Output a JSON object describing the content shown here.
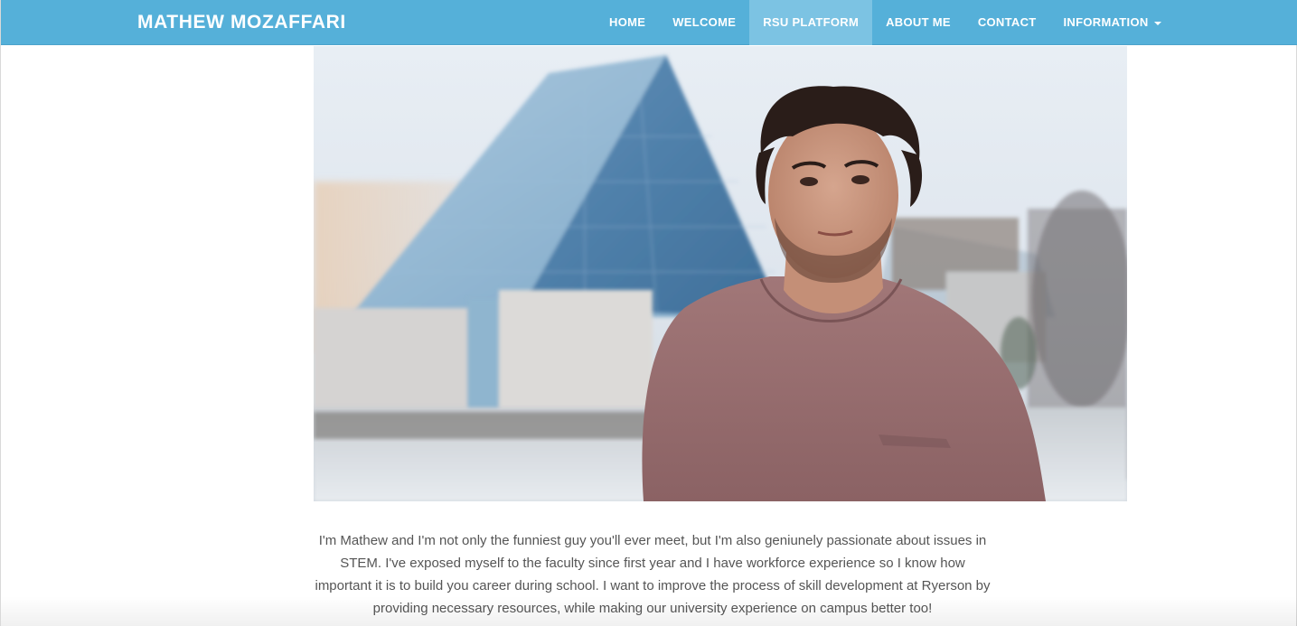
{
  "site": {
    "brand": "MATHEW MOZAFFARI"
  },
  "nav": {
    "items": [
      {
        "label": "HOME",
        "active": false
      },
      {
        "label": "WELCOME",
        "active": false
      },
      {
        "label": "RSU PLATFORM",
        "active": true
      },
      {
        "label": "ABOUT ME",
        "active": false
      },
      {
        "label": "CONTACT",
        "active": false
      },
      {
        "label": "INFORMATION",
        "active": false,
        "dropdown": true
      }
    ]
  },
  "hero": {
    "icon": "portrait-photo"
  },
  "bio": {
    "text": "I'm Mathew and I'm not only the funniest guy you'll ever meet, but I'm also geniunely passionate about issues in STEM. I've exposed myself to the faculty since first year and I have workforce experience so I know how important it is to build you career during school. I want to improve the process of skill development at Ryerson by providing necessary resources, while making our university experience on campus better too!"
  },
  "colors": {
    "navbar": "#55b0d9",
    "nav_active": "#7cc3e3",
    "text": "#555555"
  }
}
